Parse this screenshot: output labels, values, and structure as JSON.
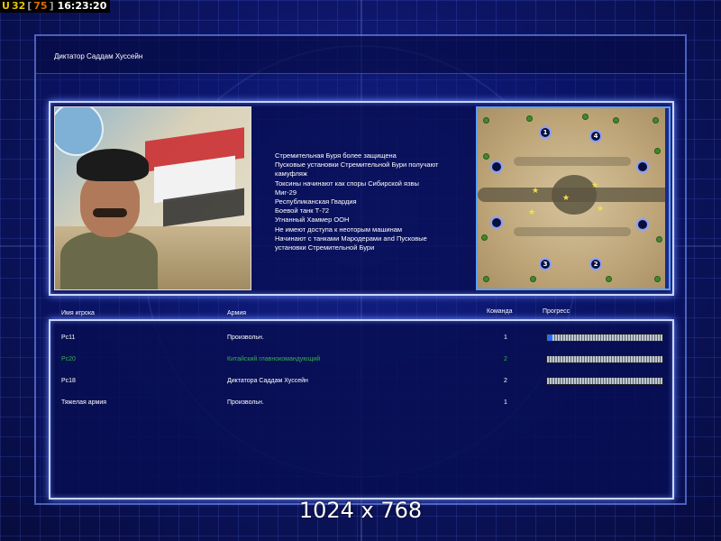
{
  "hud": {
    "prefix": "U",
    "count": "32",
    "bracket_open": "[",
    "secondary": "75",
    "bracket_close": "]",
    "time": "16:23:20"
  },
  "title": "Диктатор Саддам Хуссейн",
  "description_lines": [
    "Стремительная Буря более защищена",
    "Пусковые установки Стремительной Бури получают",
    " камуфляж",
    "Токсины начинают как споры Сибирской язвы",
    "Миг-29",
    "Республиканская Гвардия",
    "Боевой танк Т-72",
    "Угнанный Хаммер ООН",
    "Не имеют доступа к неоторым машинам",
    "Начинают с танками Мародерами and Пусковые",
    " установки Стремительной Бури"
  ],
  "minimap": {
    "start_labels": [
      "1",
      "4",
      "3",
      "2"
    ]
  },
  "columns": {
    "player": "Имя игрока",
    "army": "Армия",
    "team": "Команда",
    "progress": "Прогресс"
  },
  "players": [
    {
      "name": "Pc11",
      "army": "Произвольн.",
      "team": "1",
      "progress": 0.05,
      "highlight": false
    },
    {
      "name": "Pc20",
      "army": "Китайский главнокомандующий",
      "team": "2",
      "progress": 0.0,
      "highlight": true
    },
    {
      "name": "Pc18",
      "army": "Диктатора Саддам Хуссейн",
      "team": "2",
      "progress": 0.0,
      "highlight": false
    },
    {
      "name": "Тяжелая армия",
      "army": "Произвольн.",
      "team": "1",
      "progress": null,
      "highlight": false
    }
  ],
  "resolution_label": "1024 x 768",
  "colors": {
    "highlight_player": "#34b34a",
    "hud_count": "#e8c400",
    "hud_secondary": "#e06a00"
  }
}
